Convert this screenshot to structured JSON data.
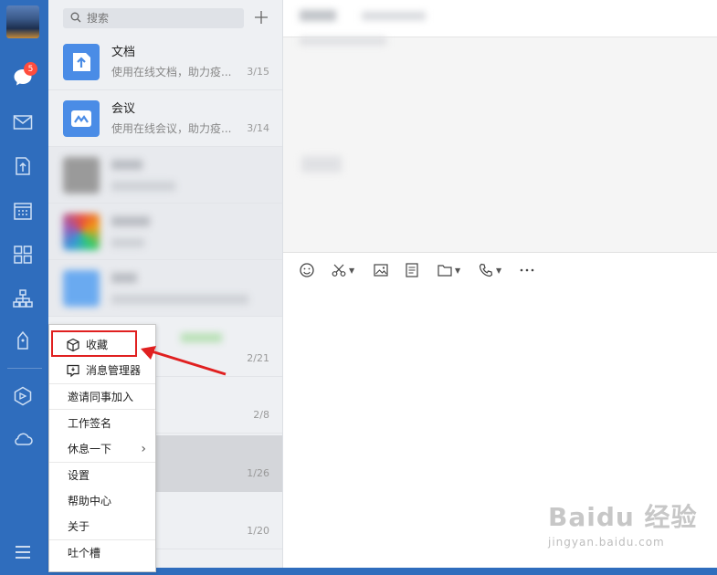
{
  "nav": {
    "badge_count": "5",
    "icons": [
      "chat-icon",
      "mail-icon",
      "document-icon",
      "calendar-icon",
      "apps-icon",
      "org-chart-icon",
      "pin-icon",
      "workbench-icon",
      "cloud-icon",
      "menu-icon"
    ]
  },
  "search": {
    "placeholder": "搜索"
  },
  "conversations": [
    {
      "title": "文档",
      "preview": "使用在线文档，助力疫...",
      "date": "3/15"
    },
    {
      "title": "会议",
      "preview": "使用在线会议，助力疫...",
      "date": "3/14"
    },
    {
      "title": "",
      "preview": "",
      "date": ""
    },
    {
      "title": "",
      "preview": "",
      "date": ""
    },
    {
      "title": "",
      "preview": "",
      "date": ""
    },
    {
      "title": "",
      "preview": "",
      "date": "2/21"
    },
    {
      "title": "",
      "preview": "",
      "date": "2/8"
    },
    {
      "title": "",
      "preview": "",
      "date": "1/26"
    },
    {
      "title": "",
      "preview": "",
      "date": "1/20"
    }
  ],
  "menu": {
    "items": [
      {
        "label": "收藏"
      },
      {
        "label": "消息管理器"
      },
      {
        "label": "邀请同事加入"
      },
      {
        "label": "工作签名"
      },
      {
        "label": "休息一下"
      },
      {
        "label": "设置"
      },
      {
        "label": "帮助中心"
      },
      {
        "label": "关于"
      },
      {
        "label": "吐个槽"
      }
    ]
  },
  "watermark": {
    "main": "Baidu 经验",
    "sub": "jingyan.baidu.com"
  },
  "colors": {
    "nav_bg": "#2f6dbd",
    "highlight": "#e02020",
    "badge": "#ff4d3d",
    "app_icon": "#4a8ce6"
  }
}
